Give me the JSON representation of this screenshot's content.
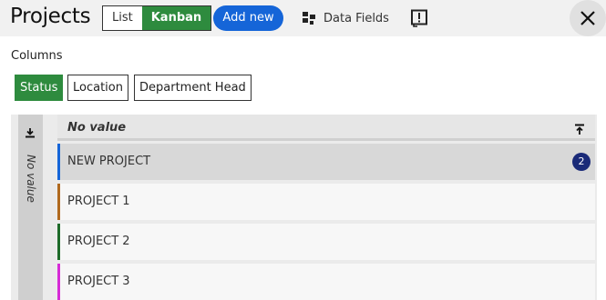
{
  "header": {
    "title": "Projects",
    "view_options": [
      "List",
      "Kanban"
    ],
    "active_view": "Kanban",
    "add_new_label": "Add new",
    "data_fields_label": "Data Fields"
  },
  "columns_section": {
    "label": "Columns",
    "chips": [
      "Status",
      "Location",
      "Department Head"
    ],
    "active_chip": "Status"
  },
  "board": {
    "collapsed_column_label": "No value",
    "column": {
      "name": "No value",
      "cards": [
        {
          "name": "NEW PROJECT",
          "color": "#1565d8",
          "badge": "2",
          "selected": true
        },
        {
          "name": "PROJECT 1",
          "color": "#b0691e",
          "badge": null,
          "selected": false
        },
        {
          "name": "PROJECT 2",
          "color": "#1e6b2a",
          "badge": null,
          "selected": false
        },
        {
          "name": "PROJECT 3",
          "color": "#d62bd6",
          "badge": null,
          "selected": false
        }
      ]
    }
  },
  "colors": {
    "accent_green": "#2e8b3e",
    "accent_blue": "#1565d8",
    "badge_navy": "#1a2a78"
  }
}
